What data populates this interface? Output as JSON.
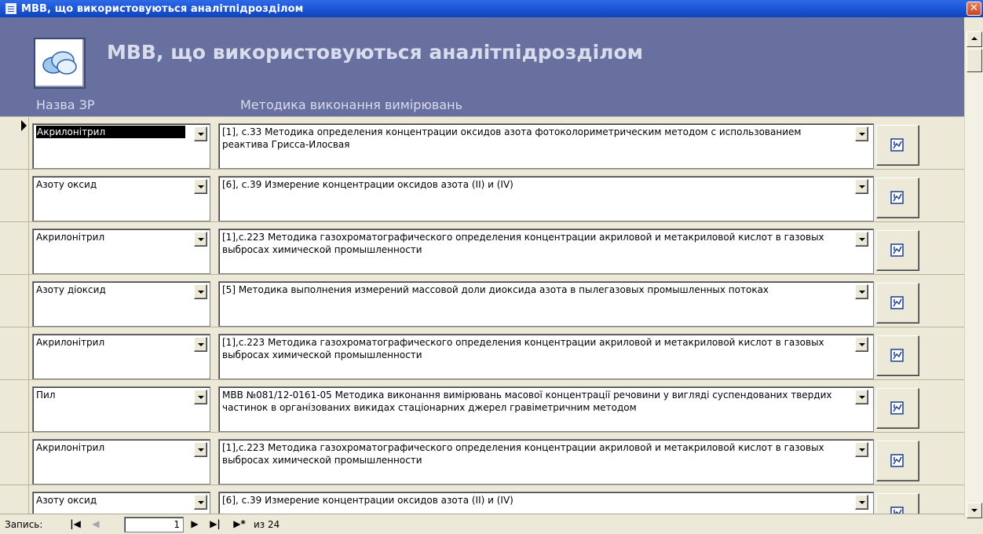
{
  "window": {
    "title": "МВВ, що використовуються аналітпідрозділом",
    "close_label": "✕"
  },
  "header": {
    "form_title": "МВВ, що використовуються аналітпідрозділом",
    "col_name": "Назва ЗР",
    "col_method": "Методика виконання вимірювань"
  },
  "rows": [
    {
      "name": "Акрилонітрил",
      "method": "[1], с.33  Методика определения концентрации оксидов азота фотоколориметрическим методом с использованием реактива Грисса-Илосвая",
      "current": true
    },
    {
      "name": "Азоту оксид",
      "method": "[6], с.39  Измерение концентрации оксидов азота (II) и (IV)"
    },
    {
      "name": "Акрилонітрил",
      "method": "[1],с.223  Методика газохроматографического определения концентрации акриловой и метакриловой кислот в газовых выбросах химической промышленности"
    },
    {
      "name": "Азоту діоксид",
      "method": "[5]  Методика выполнения измерений массовой доли диоксида азота в пылегазовых промышленных потоках"
    },
    {
      "name": "Акрилонітрил",
      "method": "[1],с.223  Методика газохроматографического определения концентрации акриловой и метакриловой кислот в газовых выбросах химической промышленности"
    },
    {
      "name": "Пил",
      "method": "МВВ №081/12-0161-05  Методика  виконання вимірювань масової концентрації  речовини у вигляді суспендованих твердих частинок в організованих викидах стаціонарних джерел гравіметричним методом"
    },
    {
      "name": "Акрилонітрил",
      "method": "[1],с.223  Методика газохроматографического определения концентрации акриловой и метакриловой кислот в газовых выбросах химической промышленности"
    },
    {
      "name": "Азоту оксид",
      "method": "[6], с.39  Измерение концентрации оксидов азота (II) и  (IV)"
    }
  ],
  "navigator": {
    "label": "Запись:",
    "first": "|◀",
    "prev": "◀",
    "current": "1",
    "next": "▶",
    "last": "▶|",
    "new": "▶*",
    "of_text": "из 24"
  },
  "icons": {
    "row_button": "report-icon",
    "logo": "cloud-icon"
  }
}
